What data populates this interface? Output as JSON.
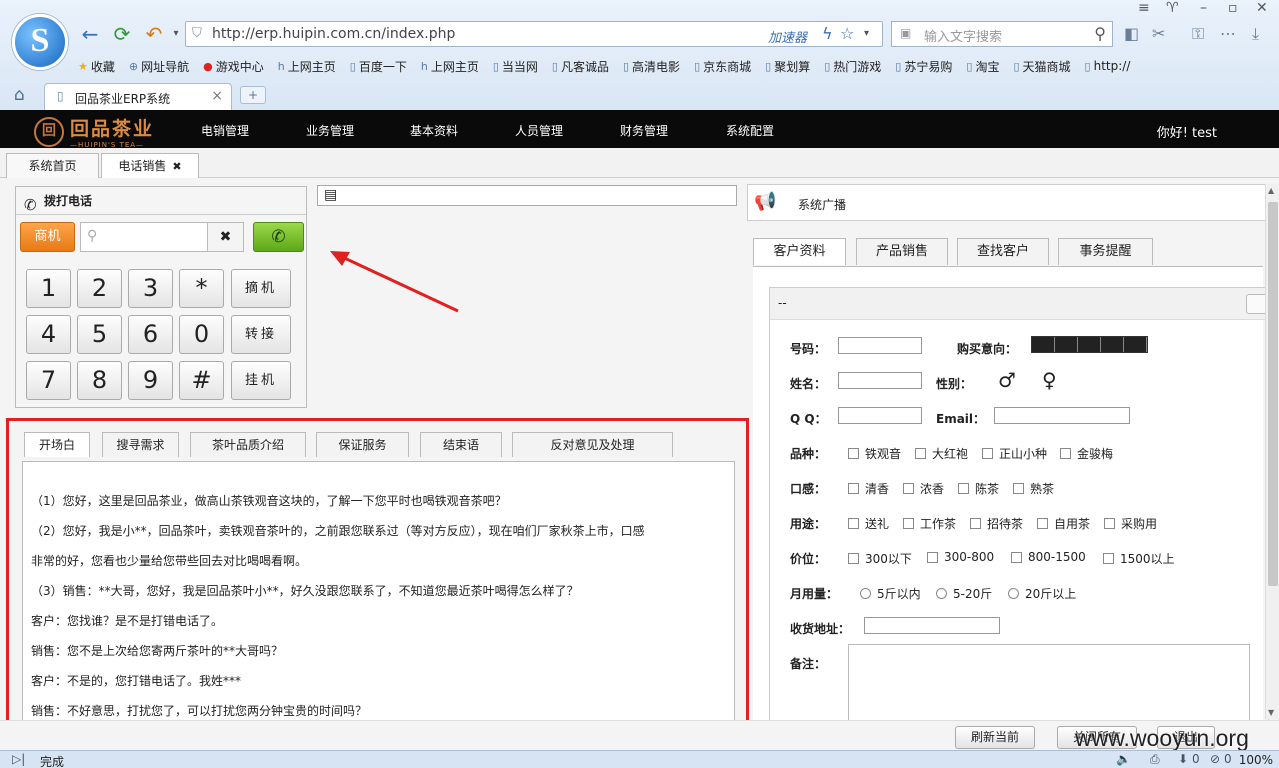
{
  "browser": {
    "url": "http://erp.huipin.com.cn/index.php",
    "accelerator_label": "加速器",
    "search_placeholder": "输入文字搜索",
    "bookmarks": [
      "收藏",
      "网址导航",
      "游戏中心",
      "上网主页",
      "百度一下",
      "上网主页",
      "当当网",
      "凡客诚品",
      "高清电影",
      "京东商城",
      "聚划算",
      "热门游戏",
      "苏宁易购",
      "淘宝",
      "天猫商城",
      "http://"
    ],
    "tab_title": "回品茶业ERP系统",
    "status_text": "完成",
    "zoom": "100%",
    "status_counts": [
      "0",
      "0"
    ]
  },
  "app": {
    "brand_cn": "回品茶业",
    "brand_en": "—HUIPIN'S TEA—",
    "menu": [
      "电销管理",
      "业务管理",
      "基本资料",
      "人员管理",
      "财务管理",
      "系统配置"
    ],
    "greeting": "你好! test"
  },
  "page_tabs": [
    "系统首页",
    "电话销售"
  ],
  "dialer": {
    "title": "拨打电话",
    "business_button": "商机",
    "keys": [
      "1",
      "2",
      "3",
      "*",
      "4",
      "5",
      "6",
      "0",
      "7",
      "8",
      "9",
      "#"
    ],
    "function_keys": [
      "摘机",
      "转接",
      "挂机"
    ]
  },
  "script": {
    "tabs": [
      "开场白",
      "搜寻需求",
      "茶叶品质介绍",
      "保证服务",
      "结束语",
      "反对意见及处理"
    ],
    "lines": [
      "（1）您好，这里是回品茶业，做高山茶铁观音这块的，了解一下您平时也喝铁观音茶吧？",
      "（2）您好，我是小**，回品茶叶，卖铁观音茶叶的，之前跟您联系过（等对方反应），现在咱们厂家秋茶上市，口感",
      "非常的好，您看也少量给您带些回去对比喝喝看啊。",
      "（3）销售：**大哥，您好，我是回品茶叶小**，好久没跟您联系了，不知道您最近茶叶喝得怎么样了？",
      "客户：您找谁？是不是打错电话了。",
      "销售：您不是上次给您寄两斤茶叶的**大哥吗？",
      "客户：不是的，您打错电话了。我姓***",
      "销售：不好意思，打扰您了，可以打扰您两分钟宝贵的时间吗？"
    ]
  },
  "broadcast": {
    "label": "系统广播"
  },
  "right_tabs": [
    "客户资料",
    "产品销售",
    "查找客户",
    "事务提醒"
  ],
  "customer_form": {
    "header": "--",
    "labels": {
      "number": "号码：",
      "intent": "购买意向：",
      "name": "姓名：",
      "gender": "性别：",
      "qq": "Q Q：",
      "email": "Email：",
      "variety": "品种：",
      "taste": "口感：",
      "usage": "用途：",
      "price": "价位：",
      "monthly": "月用量：",
      "address": "收货地址：",
      "remark": "备注："
    },
    "variety_options": [
      "铁观音",
      "大红袍",
      "正山小种",
      "金骏梅"
    ],
    "taste_options": [
      "清香",
      "浓香",
      "陈茶",
      "熟茶"
    ],
    "usage_options": [
      "送礼",
      "工作茶",
      "招待茶",
      "自用茶",
      "采购用"
    ],
    "price_options": [
      "300以下",
      "300-800",
      "800-1500",
      "1500以上"
    ],
    "monthly_options": [
      "5斤以内",
      "5-20斤",
      "20斤以上"
    ],
    "intent_level": 5
  },
  "bottom_buttons": [
    "刷新当前",
    "关闭所有",
    "退出"
  ],
  "watermark": "www.wooyun.org",
  "colors": {
    "highlight_border": "#e12020",
    "business_button": "#f08a24",
    "call_button": "#6db620",
    "appbar": "#0a0a0a"
  }
}
